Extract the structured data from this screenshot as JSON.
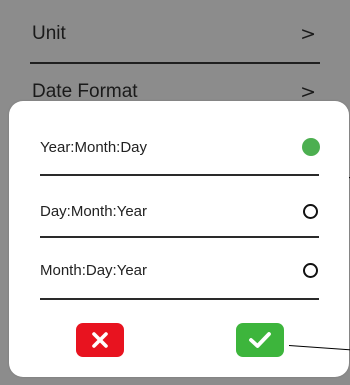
{
  "settings": {
    "rows": [
      {
        "label": "Unit",
        "chevron": ">"
      },
      {
        "label": "Date Format",
        "chevron": ">"
      }
    ]
  },
  "dialog": {
    "options": [
      {
        "label": "Year:Month:Day",
        "selected": true
      },
      {
        "label": "Day:Month:Year",
        "selected": false
      },
      {
        "label": "Month:Day:Year",
        "selected": false
      }
    ],
    "cancel_icon": "close-icon",
    "confirm_icon": "check-icon"
  },
  "colors": {
    "overlay": "#8c8c8c",
    "selected_radio": "#4caf50",
    "cancel_button": "#e8131f",
    "confirm_button": "#3db53c"
  }
}
